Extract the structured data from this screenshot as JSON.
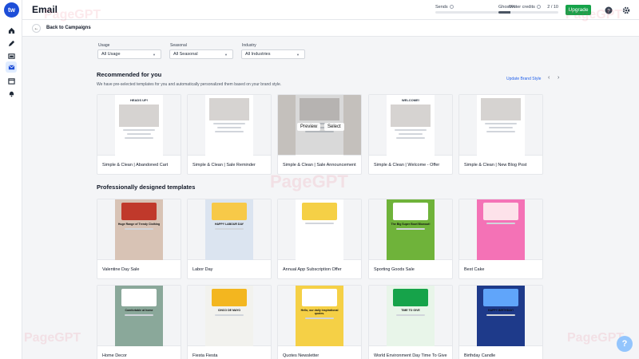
{
  "app": {
    "logo": "tw",
    "title": "Email"
  },
  "topbar": {
    "sends_label": "Sends",
    "sends_value": "0%",
    "sends_fraction": 0.0,
    "ghost_label": "Ghostwriter credits",
    "ghost_value": "2 / 10",
    "ghost_fraction": 0.2,
    "upgrade_label": "Upgrade",
    "icons": [
      "help-icon",
      "settings-icon"
    ]
  },
  "sidebar": {
    "icons": [
      "home-icon",
      "pen-icon",
      "media-icon",
      "email-icon",
      "calendar-icon",
      "bell-icon"
    ]
  },
  "back": {
    "label": "Back to Campaigns"
  },
  "filters": [
    {
      "label": "Usage",
      "value": "All Usage"
    },
    {
      "label": "Seasonal",
      "value": "All Seasonal"
    },
    {
      "label": "Industry",
      "value": "All Industries"
    }
  ],
  "recommended": {
    "title": "Recommended for you",
    "subtitle": "We have pre-selected templates for you and automatically personalized them based on your brand style.",
    "update_brand": "Update Brand Style",
    "hover_preview": "Preview",
    "hover_select": "Select",
    "cards": [
      {
        "name": "Simple & Clean | Abandoned Cart",
        "headline": "HEADS UP!",
        "bg": "#f3f4f6"
      },
      {
        "name": "Simple & Clean | Sale Reminder",
        "headline": "",
        "bg": "#f3f4f6"
      },
      {
        "name": "Simple & Clean | Sale Announcement",
        "headline": "",
        "bg": "#e7e2dd"
      },
      {
        "name": "Simple & Clean | Welcome - Offer",
        "headline": "WELCOME!",
        "bg": "#f3f4f6"
      },
      {
        "name": "Simple & Clean | New Blog Post",
        "headline": "",
        "bg": "#f3f4f6"
      }
    ]
  },
  "professional": {
    "title": "Professionally designed templates",
    "row1": [
      {
        "name": "Valentine Day Sale",
        "bg": "#d8c3b5",
        "accent": "#c0392b",
        "caption": "Huge Range of Trendy Clothing"
      },
      {
        "name": "Labor Day",
        "bg": "#dbe4f0",
        "accent": "#f7c948",
        "caption": "HAPPY LABOUR DAY"
      },
      {
        "name": "Annual App Subscription Offer",
        "bg": "#ffffff",
        "accent": "#f5d046",
        "caption": ""
      },
      {
        "name": "Sporting Goods Sale",
        "bg": "#6fb33a",
        "accent": "#ffffff",
        "caption": "The Big Super Bowl Blowout!"
      },
      {
        "name": "Best Cake",
        "bg": "#f472b6",
        "accent": "#fde2ea",
        "caption": ""
      }
    ],
    "row2": [
      {
        "name": "Home Decor",
        "bg": "#8aa89a",
        "accent": "#ffffff",
        "caption": "Comfortable at home"
      },
      {
        "name": "Fiesta Fiesta",
        "bg": "#f2f2ee",
        "accent": "#f3b61f",
        "caption": "CINCO DE MAYO"
      },
      {
        "name": "Quotes Newsletter",
        "bg": "#f5d046",
        "accent": "#ffffff",
        "caption": "Hello, our daily inspirational quotes."
      },
      {
        "name": "World Environment Day Time To Give",
        "bg": "#e8f5e9",
        "accent": "#16a34a",
        "caption": "TIME TO GIVE"
      },
      {
        "name": "Birthday Candle",
        "bg": "#1e3a8a",
        "accent": "#60a5fa",
        "caption": "HAPPY BIRTHDAY!"
      }
    ]
  },
  "watermark": "PageGPT",
  "help_button": "?"
}
